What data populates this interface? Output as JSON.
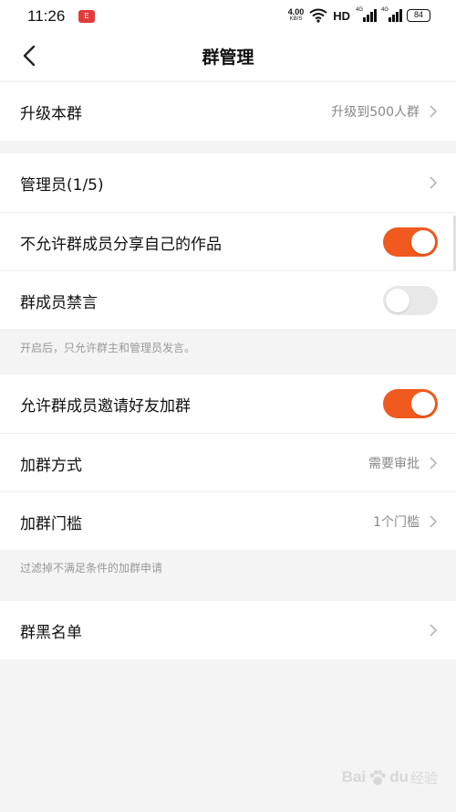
{
  "status_bar": {
    "time": "11:26",
    "notification_badge": "E",
    "net_speed_value": "4.00",
    "net_speed_unit": "KB/S",
    "hd": "HD",
    "signal1_label": "4G",
    "signal2_label": "4G",
    "battery": "84",
    "icons": [
      "notification-badge-icon",
      "wifi-icon",
      "signal-icon",
      "battery-icon"
    ]
  },
  "navbar": {
    "title": "群管理",
    "back_icon": "chevron-left-icon"
  },
  "upgrade": {
    "label": "升级本群",
    "value": "升级到500人群"
  },
  "admin_section": {
    "admins_label": "管理员(1/5)",
    "share_label": "不允许群成员分享自己的作品",
    "share_enabled": true,
    "mute_label": "群成员禁言",
    "mute_enabled": false,
    "mute_hint": "开启后，只允许群主和管理员发言。"
  },
  "join_section": {
    "invite_label": "允许群成员邀请好友加群",
    "invite_enabled": true,
    "method_label": "加群方式",
    "method_value": "需要审批",
    "threshold_label": "加群门槛",
    "threshold_value": "1个门槛",
    "hint": "过滤掉不满足条件的加群申请"
  },
  "blacklist": {
    "label": "群黑名单"
  },
  "colors": {
    "accent": "#f05a1e",
    "toggle_off": "#e8e8e8",
    "background": "#f4f4f5"
  },
  "watermark": {
    "brand": "Bai",
    "brand2": "du",
    "suffix": "经验"
  }
}
